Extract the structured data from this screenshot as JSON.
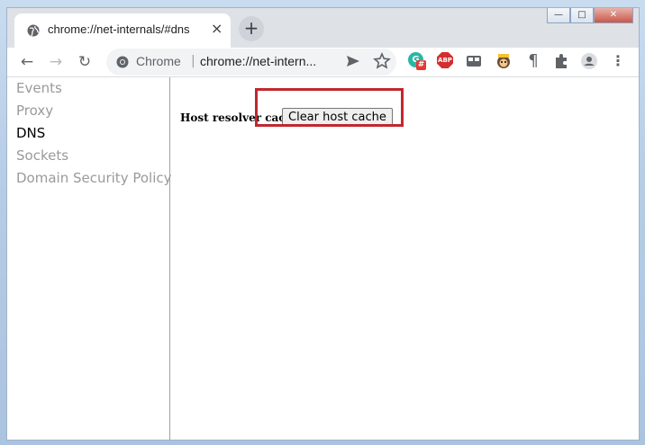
{
  "window": {
    "tab_title": "chrome://net-internals/#dns",
    "tab_close": "×",
    "new_tab": "+",
    "win_minimize": "—",
    "win_maximize": "□",
    "win_close": "✕"
  },
  "toolbar": {
    "back": "←",
    "forward": "→",
    "reload": "↻",
    "site_label": "Chrome",
    "separator": "|",
    "url": "chrome://net-intern...",
    "extensions": {
      "grammarly_badge": "#",
      "abp_label": "ABP",
      "pilcrow": "¶",
      "menu": "⋮"
    }
  },
  "sidebar": {
    "items": [
      {
        "label": "Events",
        "selected": false
      },
      {
        "label": "Proxy",
        "selected": false
      },
      {
        "label": "DNS",
        "selected": true
      },
      {
        "label": "Sockets",
        "selected": false
      },
      {
        "label": "Domain Security Policy",
        "selected": false
      }
    ]
  },
  "dns": {
    "resolver_label": "Host resolver cache",
    "clear_button": "Clear host cache"
  },
  "colors": {
    "highlight": "#c0282e",
    "selected_nav": "#000000",
    "unselected_nav": "#9a9a9a"
  }
}
